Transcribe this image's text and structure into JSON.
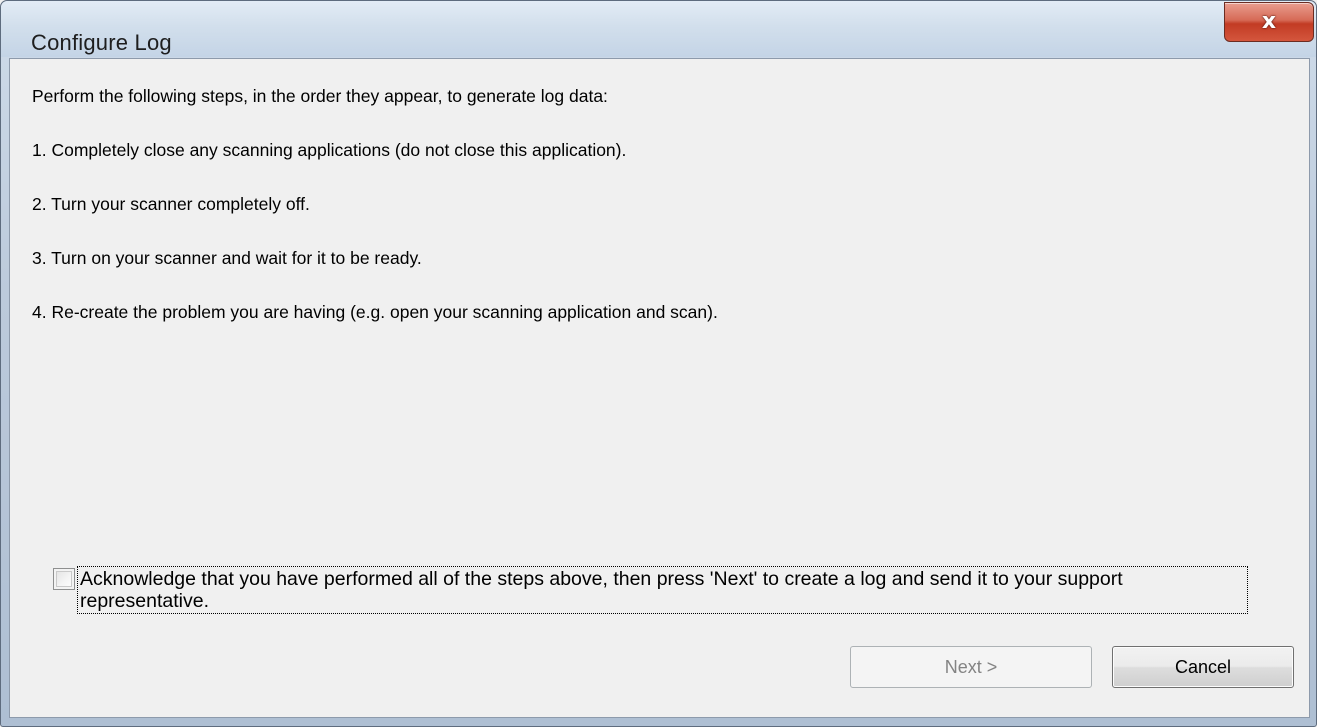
{
  "window": {
    "title": "Configure Log",
    "close_glyph": "x"
  },
  "content": {
    "intro": "Perform the following steps, in the order they appear, to generate log data:",
    "steps": [
      "1. Completely close any scanning applications (do not close this application).",
      "2. Turn your scanner completely off.",
      "3. Turn on your scanner and wait for it to be ready.",
      "4. Re-create the problem you are having (e.g. open your scanning application and scan)."
    ]
  },
  "acknowledge": {
    "checked": false,
    "label": "Acknowledge that you have performed all of the steps above, then press 'Next' to create a log and send it to your support representative."
  },
  "buttons": {
    "next_label": "Next >",
    "next_enabled": false,
    "cancel_label": "Cancel"
  }
}
